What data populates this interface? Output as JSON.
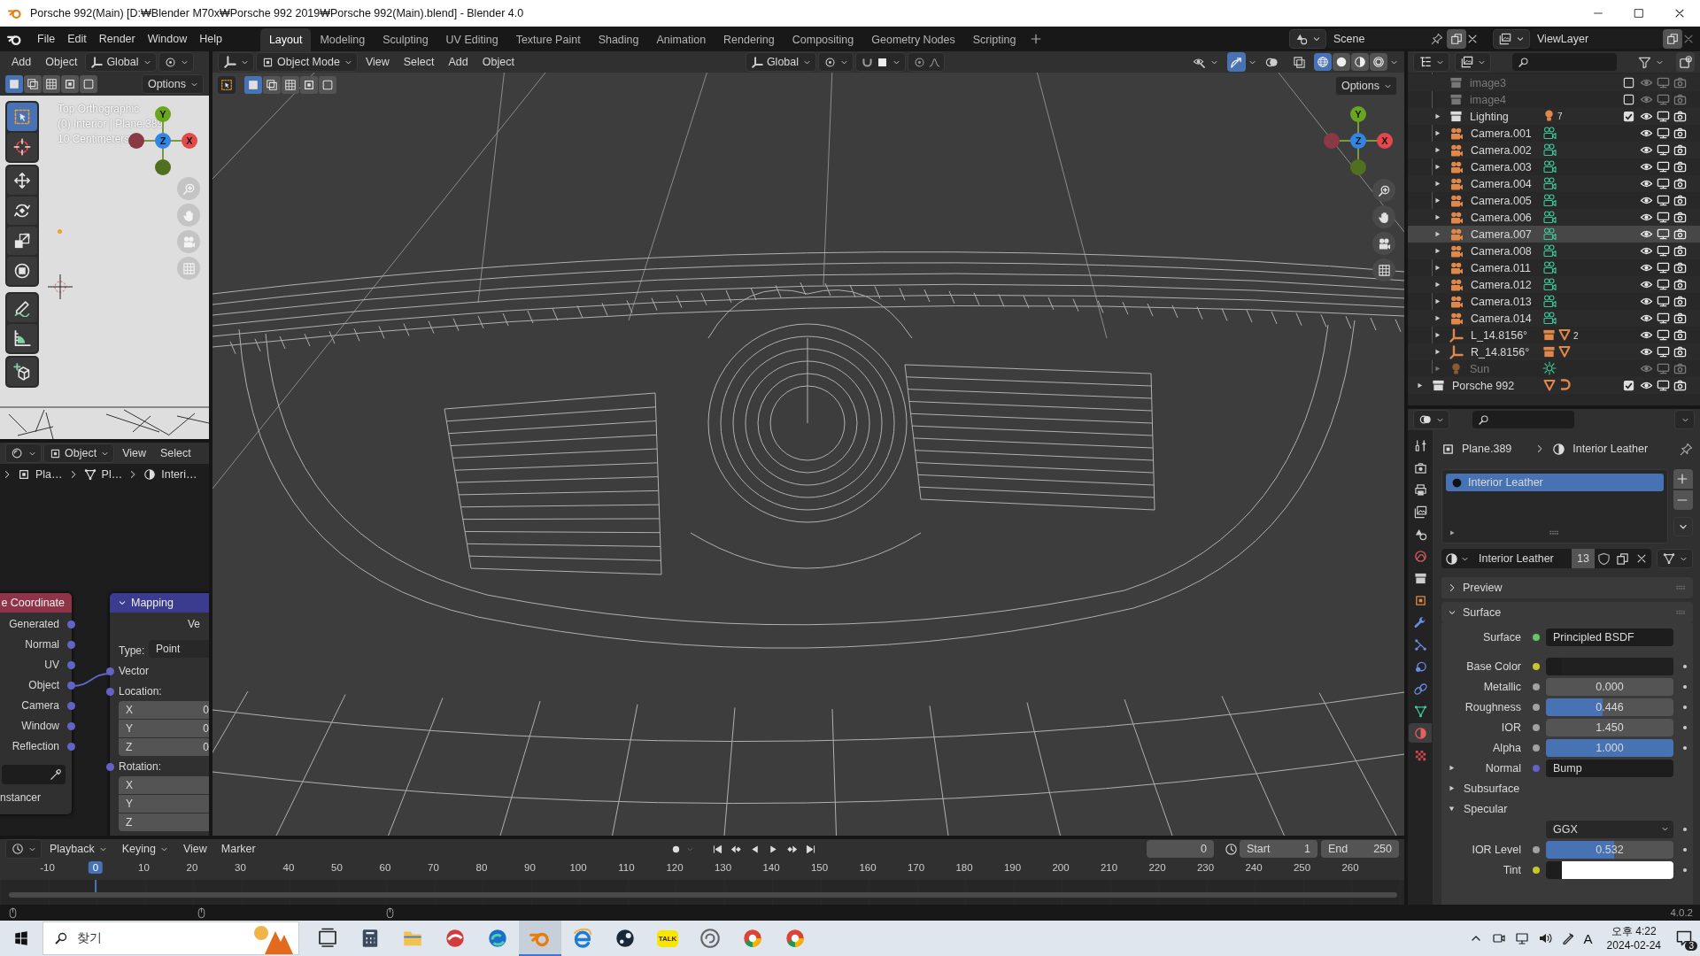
{
  "window": {
    "title": "Porsche 992(Main) [D:₩Blender M70x₩Porsche 992 2019₩Porsche 992(Main).blend] - Blender 4.0"
  },
  "menu": [
    "File",
    "Edit",
    "Render",
    "Window",
    "Help"
  ],
  "workspaces": [
    {
      "label": "Layout",
      "selected": true
    },
    {
      "label": "Modeling",
      "selected": false
    },
    {
      "label": "Sculpting",
      "selected": false
    },
    {
      "label": "UV Editing",
      "selected": false
    },
    {
      "label": "Texture Paint",
      "selected": false
    },
    {
      "label": "Shading",
      "selected": false
    },
    {
      "label": "Animation",
      "selected": false
    },
    {
      "label": "Rendering",
      "selected": false
    },
    {
      "label": "Compositing",
      "selected": false
    },
    {
      "label": "Geometry Nodes",
      "selected": false
    },
    {
      "label": "Scripting",
      "selected": false
    }
  ],
  "scene": {
    "name": "Scene"
  },
  "view_layer": {
    "name": "ViewLayer"
  },
  "mini_viewport": {
    "menus": [
      "Add",
      "Object"
    ],
    "orientation": "Global",
    "select_modes": [
      {
        "selected": true
      },
      {
        "selected": false
      },
      {
        "selected": false
      },
      {
        "selected": false
      },
      {
        "selected": false
      }
    ],
    "options": "Options",
    "tools": [
      {
        "selected": true
      },
      {
        "selected": false
      },
      {
        "selected": false
      },
      {
        "selected": false
      },
      {
        "selected": false
      },
      {
        "selected": false
      },
      {
        "selected": false
      },
      {
        "selected": false
      },
      {
        "selected": false
      }
    ],
    "overlay": [
      "Top Orthographic",
      "(0) Interior | Plane.389",
      "10 Centimeters"
    ],
    "gizmo": {
      "x": "X",
      "y": "Y",
      "z": "Z"
    }
  },
  "node_editor": {
    "mode": "Object",
    "menus": [
      "View",
      "Select"
    ],
    "breadcrumbs": [
      "Pla…",
      "Pl…",
      "Interi…"
    ],
    "coordinate_node": {
      "title": "e Coordinate",
      "outputs": [
        "Generated",
        "Normal",
        "UV",
        "Object",
        "Camera",
        "Window",
        "Reflection"
      ],
      "footer": "nstancer"
    },
    "mapping_node": {
      "title": "Mapping",
      "output": "Ve",
      "type_label": "Type:",
      "type_value": "Point",
      "vector": "Vector",
      "location": "Location:",
      "location_fields": [
        {
          "axis": "X",
          "value": "0"
        },
        {
          "axis": "Y",
          "value": "0"
        },
        {
          "axis": "Z",
          "value": "0"
        }
      ],
      "rotation": "Rotation:",
      "rotation_fields": [
        {
          "axis": "X"
        },
        {
          "axis": "Y"
        },
        {
          "axis": "Z"
        }
      ]
    }
  },
  "viewport": {
    "mode": "Object Mode",
    "menus": [
      "View",
      "Select",
      "Add",
      "Object"
    ],
    "orientation": "Global",
    "select_modes": [
      {
        "selected": true
      },
      {
        "selected": false
      },
      {
        "selected": false
      },
      {
        "selected": false
      },
      {
        "selected": false
      }
    ],
    "options": "Options",
    "shading": [
      {
        "selected": true
      },
      {
        "selected": false
      },
      {
        "selected": false
      },
      {
        "selected": false
      }
    ],
    "gizmo": {
      "x": "X",
      "y": "Y",
      "z": "Z"
    }
  },
  "outliner": {
    "rows": [
      {
        "children": [
          {
            "kind": "collection",
            "label": "image3",
            "checked": false,
            "disabled": true,
            "selected": false
          },
          {
            "kind": "collection",
            "label": "image4",
            "checked": false,
            "disabled": true,
            "selected": false
          },
          {
            "kind": "collection",
            "label": "Lighting",
            "checked": true,
            "count": "7",
            "expanded": false,
            "disabled": false,
            "selected": false
          },
          {
            "kind": "camera",
            "label": "Camera.001",
            "expanded": false,
            "disabled": false,
            "selected": false
          },
          {
            "kind": "camera",
            "label": "Camera.002",
            "expanded": false,
            "disabled": false,
            "selected": false
          },
          {
            "kind": "camera",
            "label": "Camera.003",
            "expanded": false,
            "disabled": false,
            "selected": false
          },
          {
            "kind": "camera",
            "label": "Camera.004",
            "expanded": false,
            "disabled": false,
            "selected": false
          },
          {
            "kind": "camera",
            "label": "Camera.005",
            "expanded": false,
            "disabled": false,
            "selected": false
          },
          {
            "kind": "camera",
            "label": "Camera.006",
            "expanded": false,
            "disabled": false,
            "selected": false
          },
          {
            "kind": "camera",
            "label": "Camera.007",
            "expanded": false,
            "disabled": false,
            "selected": true
          },
          {
            "kind": "camera",
            "label": "Camera.008",
            "expanded": false,
            "disabled": false,
            "selected": false
          },
          {
            "kind": "camera",
            "label": "Camera.011",
            "expanded": false,
            "disabled": false,
            "selected": false
          },
          {
            "kind": "camera",
            "label": "Camera.012",
            "expanded": false,
            "disabled": false,
            "selected": false
          },
          {
            "kind": "camera",
            "label": "Camera.013",
            "expanded": false,
            "disabled": false,
            "selected": false
          },
          {
            "kind": "camera",
            "label": "Camera.014",
            "expanded": false,
            "disabled": false,
            "selected": false
          },
          {
            "kind": "empty",
            "label": "L_14.8156°",
            "count": "2",
            "expanded": false,
            "disabled": false,
            "selected": false
          },
          {
            "kind": "empty",
            "label": "R_14.8156°",
            "expanded": false,
            "disabled": false,
            "selected": false
          },
          {
            "kind": "light",
            "label": "Sun",
            "expanded": false,
            "disabled": true,
            "selected": false
          }
        ]
      },
      {
        "kind": "collection",
        "label": "Porsche 992",
        "checked": true,
        "expanded": false,
        "disabled": false,
        "selected": false
      }
    ]
  },
  "properties": {
    "tabs": [
      {
        "selected": false
      },
      {
        "selected": false
      },
      {
        "selected": false
      },
      {
        "selected": false
      },
      {
        "selected": false
      },
      {
        "selected": false
      },
      {
        "selected": false
      },
      {
        "selected": false
      },
      {
        "selected": false
      },
      {
        "selected": false
      },
      {
        "selected": false
      },
      {
        "selected": false
      },
      {
        "selected": false
      },
      {
        "selected": true
      },
      {
        "selected": false
      }
    ],
    "breadcrumb": [
      "Plane.389",
      "Interior Leather"
    ],
    "slots": [
      {
        "label": "Interior Leather",
        "selected": true
      }
    ],
    "material": {
      "name": "Interior Leather",
      "users": "13"
    },
    "panels": [
      {
        "label": "Preview",
        "expanded": false
      },
      {
        "label": "Surface",
        "expanded": true
      }
    ],
    "inputs": [
      {
        "kind": "link",
        "label": "Surface",
        "value": "Principled BSDF",
        "socket": {
          "color": "#63c763"
        }
      },
      {
        "kind": "color",
        "label": "Base Color",
        "socket": {
          "color": "#c7c729"
        },
        "color": "#202020"
      },
      {
        "kind": "slider",
        "label": "Metallic",
        "value": "0.000",
        "level": 0,
        "socket": {
          "color": "#a1a1a1"
        }
      },
      {
        "kind": "slider",
        "label": "Roughness",
        "value": "0.446",
        "level": 0.446,
        "socket": {
          "color": "#a1a1a1"
        }
      },
      {
        "kind": "number",
        "label": "IOR",
        "value": "1.450",
        "socket": {
          "color": "#a1a1a1"
        }
      },
      {
        "kind": "slider",
        "label": "Alpha",
        "value": "1.000",
        "level": 1,
        "socket": {
          "color": "#a1a1a1"
        }
      },
      {
        "kind": "link",
        "label": "Normal",
        "value": "Bump",
        "socket": {
          "color": "#6363c7"
        },
        "expanded": false
      },
      {
        "kind": "section",
        "label": "Subsurface",
        "expanded": false
      },
      {
        "kind": "section",
        "label": "Specular",
        "expanded": true
      },
      {
        "kind": "menu",
        "value": "GGX"
      },
      {
        "kind": "slider",
        "label": "IOR Level",
        "value": "0.532",
        "level": 0.532,
        "socket": {
          "color": "#a1a1a1"
        }
      },
      {
        "kind": "color",
        "label": "Tint",
        "socket": {
          "color": "#c7c729"
        },
        "color": "#ffffff"
      }
    ]
  },
  "timeline": {
    "menus": [
      {
        "label": "Playback",
        "dropdown": true
      },
      {
        "label": "Keying",
        "dropdown": true
      },
      {
        "label": "View",
        "dropdown": false
      },
      {
        "label": "Marker",
        "dropdown": false
      }
    ],
    "frame": "0",
    "start": {
      "label": "Start",
      "value": "1"
    },
    "end": {
      "label": "End",
      "value": "250"
    },
    "ticks": [
      {
        "label": "-10",
        "selected": false
      },
      {
        "label": "0",
        "selected": true
      },
      {
        "label": "10",
        "selected": false
      },
      {
        "label": "20",
        "selected": false
      },
      {
        "label": "30",
        "selected": false
      },
      {
        "label": "40",
        "selected": false
      },
      {
        "label": "50",
        "selected": false
      },
      {
        "label": "60",
        "selected": false
      },
      {
        "label": "70",
        "selected": false
      },
      {
        "label": "80",
        "selected": false
      },
      {
        "label": "90",
        "selected": false
      },
      {
        "label": "100",
        "selected": false
      },
      {
        "label": "110",
        "selected": false
      },
      {
        "label": "120",
        "selected": false
      },
      {
        "label": "130",
        "selected": false
      },
      {
        "label": "140",
        "selected": false
      },
      {
        "label": "150",
        "selected": false
      },
      {
        "label": "160",
        "selected": false
      },
      {
        "label": "170",
        "selected": false
      },
      {
        "label": "180",
        "selected": false
      },
      {
        "label": "190",
        "selected": false
      },
      {
        "label": "200",
        "selected": false
      },
      {
        "label": "210",
        "selected": false
      },
      {
        "label": "220",
        "selected": false
      },
      {
        "label": "230",
        "selected": false
      },
      {
        "label": "240",
        "selected": false
      },
      {
        "label": "250",
        "selected": false
      },
      {
        "label": "260",
        "selected": false
      }
    ]
  },
  "status_bar": {
    "version": "4.0.2"
  },
  "taskbar": {
    "search": {
      "placeholder": "찾기"
    },
    "apps": [
      {
        "selected": false
      },
      {
        "selected": false
      },
      {
        "selected": false
      },
      {
        "selected": false
      },
      {
        "selected": false
      },
      {
        "selected": true
      },
      {
        "selected": false
      },
      {
        "selected": false
      },
      {
        "selected": false,
        "label": "TALK"
      },
      {
        "selected": false
      },
      {
        "selected": false
      },
      {
        "selected": false
      }
    ],
    "ime": "A",
    "clock": {
      "time": "오후 4:22",
      "date": "2024-02-24"
    },
    "notifications": "3"
  }
}
